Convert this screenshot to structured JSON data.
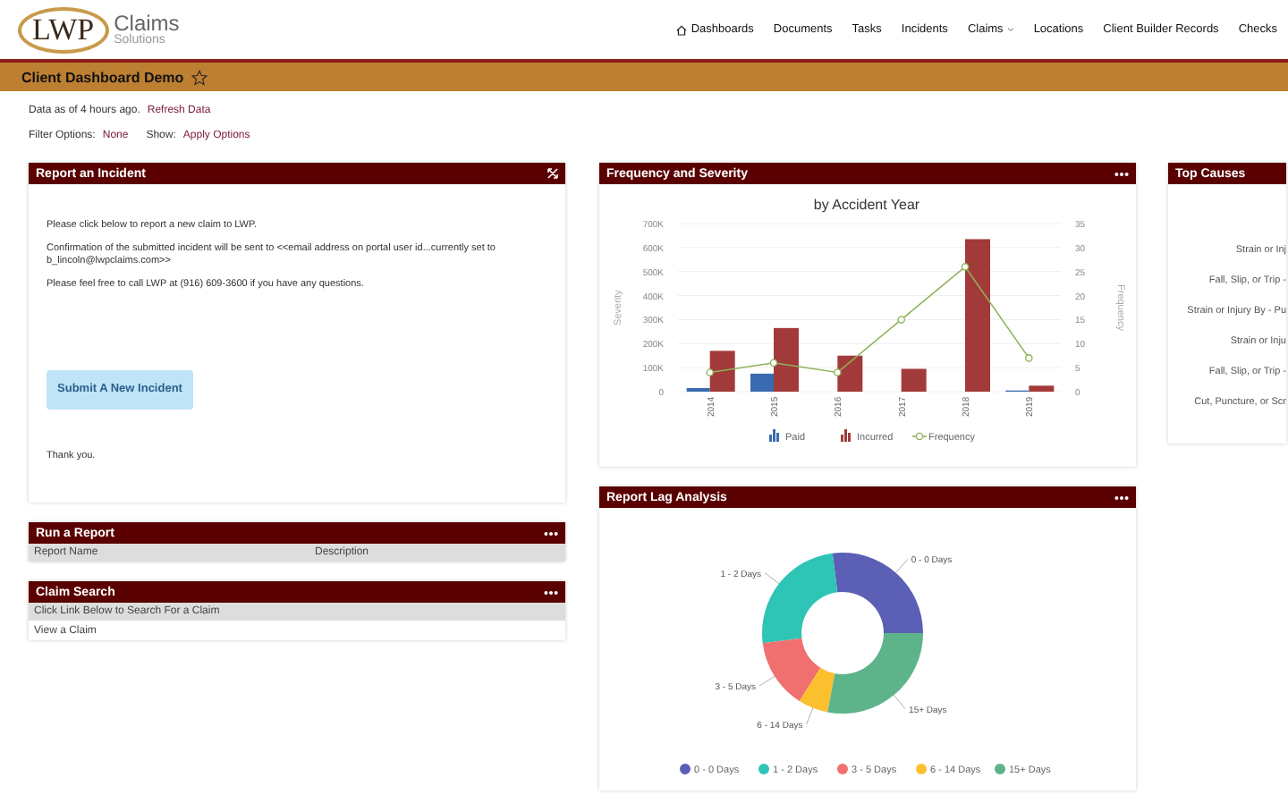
{
  "header": {
    "logo": {
      "mark": "LWP",
      "name": "Claims",
      "tagline": "Solutions"
    },
    "nav": [
      {
        "label": "Dashboards",
        "kind": "home"
      },
      {
        "label": "Documents",
        "kind": "plain"
      },
      {
        "label": "Tasks",
        "kind": "plain"
      },
      {
        "label": "Incidents",
        "kind": "plain"
      },
      {
        "label": "Claims",
        "kind": "dropdown"
      },
      {
        "label": "Locations",
        "kind": "plain"
      },
      {
        "label": "Client Builder Records",
        "kind": "plain"
      },
      {
        "label": "Checks",
        "kind": "plain"
      }
    ]
  },
  "title_bar": {
    "title": "Client Dashboard Demo",
    "favorite": false
  },
  "data_info": {
    "text": "Data as of 4 hours ago.",
    "link": "Refresh Data"
  },
  "filters": {
    "label": "Filter Options:",
    "value": "None",
    "show_label": "Show:",
    "link": "Apply Options"
  },
  "report_incident": {
    "title": "Report an Incident",
    "paragraphs": [
      "Please click below to report a new claim to LWP.",
      "Confirmation of the submitted incident will be sent to  <<email address on portal user id...currently set to b_lincoln@lwpclaims.com>>",
      "Please feel free to call LWP at (916) 609-3600 if you have any questions."
    ],
    "button": "Submit A New Incident",
    "footer": "Thank you."
  },
  "run_report": {
    "title": "Run a Report",
    "columns": [
      "Report Name",
      "Description"
    ]
  },
  "claim_search": {
    "title": "Claim Search",
    "subheader": "Click Link Below to Search For a Claim",
    "link": "View a Claim"
  },
  "frequency_severity": {
    "title": "Frequency and Severity",
    "chart_data": {
      "type": "bar",
      "title": "by Accident Year",
      "ylabel": "Severity",
      "categories": [
        "2014",
        "2015",
        "2016",
        "2017",
        "2018",
        "2019"
      ],
      "series": [
        {
          "name": "Paid",
          "color": "#3a6bb0",
          "values": [
            15000,
            75000,
            0,
            0,
            0,
            5000
          ]
        },
        {
          "name": "Incurred",
          "color": "#a33a3a",
          "values": [
            170000,
            265000,
            150000,
            95000,
            635000,
            25000
          ]
        },
        {
          "name": "Frequency",
          "color": "#8fb35a",
          "type": "line",
          "axis": "y2",
          "marker": "circle",
          "values": [
            4,
            6,
            4,
            15,
            26,
            7
          ]
        }
      ],
      "ylim": [
        0,
        700000
      ],
      "y2lim": [
        0,
        35
      ],
      "grid": true,
      "legend": "bottom",
      "yticks": [
        {
          "value": 0,
          "label": "0"
        },
        {
          "value": 100000,
          "label": "100K"
        },
        {
          "value": 200000,
          "label": "200K"
        },
        {
          "value": 300000,
          "label": "300K"
        },
        {
          "value": 400000,
          "label": "400K"
        },
        {
          "value": 500000,
          "label": "500K"
        },
        {
          "value": 600000,
          "label": "600K"
        },
        {
          "value": 700000,
          "label": "700K"
        }
      ],
      "y2label": "Frequency",
      "y2ticks": [
        0,
        5,
        10,
        15,
        20,
        25,
        30,
        35
      ]
    }
  },
  "report_lag": {
    "title": "Report Lag Analysis",
    "chart_data": {
      "type": "donut",
      "categories": [
        "0 - 0 Days",
        "1 - 2 Days",
        "3 - 5 Days",
        "6 - 14 Days",
        "15+ Days"
      ],
      "series": [
        {
          "values": [
            27,
            25,
            14,
            6,
            28
          ]
        }
      ],
      "legend": "bottom",
      "colors": [
        "#5b5fb5",
        "#2ec4b6",
        "#f07070",
        "#fcc02e",
        "#5db38a"
      ]
    }
  },
  "top_causes": {
    "title": "Top Causes",
    "labels": [
      "Strain or Inj",
      "Fall, Slip, or Trip -",
      "Strain or Injury By - Pu",
      "Strain or Inju",
      "Fall, Slip, or Trip -",
      "Cut, Puncture, or Scr"
    ]
  }
}
